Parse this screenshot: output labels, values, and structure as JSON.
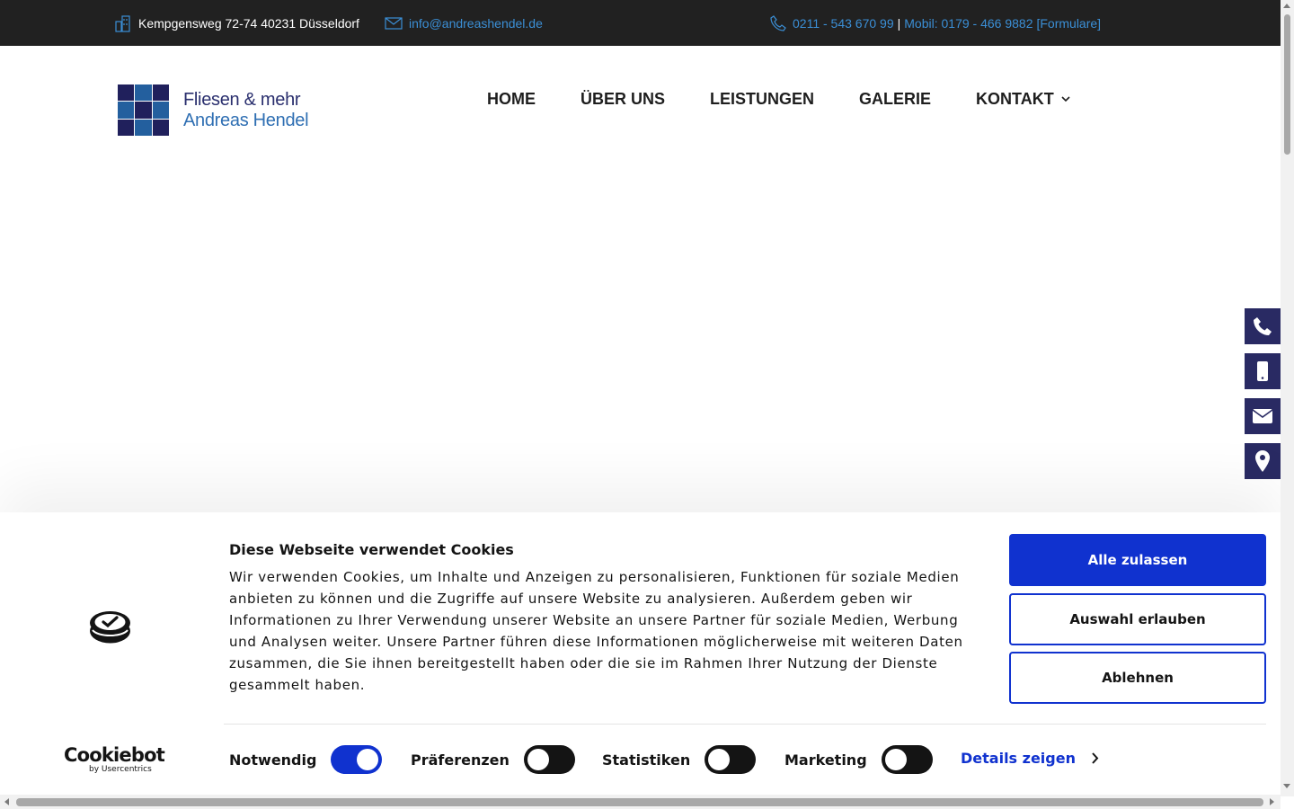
{
  "topbar": {
    "address": "Kempgensweg 72-74 40231 Düsseldorf",
    "email": "info@andreashendel.de",
    "phone": "0211 - 543 670 99",
    "separator": "|",
    "mobile": "Mobil: 0179 - 466 9882",
    "forms": "[Formulare]"
  },
  "logo": {
    "line1": "Fliesen & mehr",
    "line2": "Andreas Hendel",
    "colors": [
      "#20205c",
      "#235f9e",
      "#20205c",
      "#235f9e",
      "#20205c",
      "#235f9e",
      "#20205c",
      "#235f9e",
      "#20205c"
    ]
  },
  "nav": {
    "items": [
      "HOME",
      "ÜBER UNS",
      "LEISTUNGEN",
      "GALERIE",
      "KONTAKT"
    ]
  },
  "side_buttons": [
    "phone-icon",
    "mobile-icon",
    "envelope-icon",
    "map-marker-icon"
  ],
  "cookie": {
    "title": "Diese Webseite verwendet Cookies",
    "text": "Wir verwenden Cookies, um Inhalte und Anzeigen zu personalisieren, Funktionen für soziale Medien anbieten zu können und die Zugriffe auf unsere Website zu analysieren. Außerdem geben wir Informationen zu Ihrer Verwendung unserer Website an unsere Partner für soziale Medien, Werbung und Analysen weiter. Unsere Partner führen diese Informationen möglicherweise mit weiteren Daten zusammen, die Sie ihnen bereitgestellt haben oder die sie im Rahmen Ihrer Nutzung der Dienste gesammelt haben.",
    "allow_all": "Alle zulassen",
    "allow_selection": "Auswahl erlauben",
    "deny": "Ablehnen",
    "brand": "Cookiebot",
    "brand_sub": "by Usercentrics",
    "toggles": {
      "necessary": {
        "label": "Notwendig",
        "on": true
      },
      "preferences": {
        "label": "Präferenzen",
        "on": false
      },
      "statistics": {
        "label": "Statistiken",
        "on": false
      },
      "marketing": {
        "label": "Marketing",
        "on": false
      }
    },
    "details": "Details zeigen"
  },
  "colors": {
    "topbar_bg": "#212121",
    "link": "#3b8fd6",
    "accent": "#1032cf",
    "side_button": "#292a63"
  }
}
